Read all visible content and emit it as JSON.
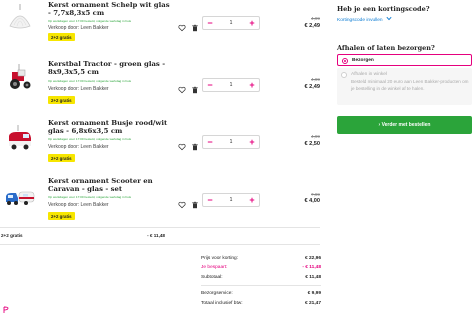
{
  "cart": {
    "items": [
      {
        "title": "Kerst ornament Schelp wit glas - 7,7x8,3x5 cm",
        "delivery": "Op werkdagen voor 17:00 besteld, volgende werkdag in huis",
        "seller": "Verkoop door: Leen Bakker",
        "badge": "2+2 gratis",
        "quantity": "1",
        "old_price": "4,99",
        "new_price": "€ 2,49",
        "thumb_icon": "shell-ornament-icon"
      },
      {
        "title": "Kerstbal Tractor - groen glas - 8x9,3x5,5 cm",
        "delivery": "Op werkdagen voor 17:00 besteld, volgende werkdag in huis",
        "seller": "Verkoop door: Leen Bakker",
        "badge": "2+2 gratis",
        "quantity": "1",
        "old_price": "4,99",
        "new_price": "€ 2,49",
        "thumb_icon": "tractor-ornament-icon"
      },
      {
        "title": "Kerst ornament Busje rood/wit glas - 6,8x6x3,5 cm",
        "delivery": "Op werkdagen voor 17:00 besteld, volgende werkdag in huis",
        "seller": "Verkoop door: Leen Bakker",
        "badge": "2+2 gratis",
        "quantity": "1",
        "old_price": "4,99",
        "new_price": "€ 2,50",
        "thumb_icon": "van-ornament-icon"
      },
      {
        "title": "Kerst ornament Scooter en Caravan - glas - set",
        "delivery": "Op werkdagen voor 17:00 besteld, volgende werkdag in huis",
        "seller": "Verkoop door: Leen Bakker",
        "badge": "2+2 gratis",
        "quantity": "1",
        "old_price": "7,99",
        "new_price": "€ 4,00",
        "thumb_icon": "scooter-caravan-ornament-icon"
      }
    ],
    "discount_label": "2+2 gratis",
    "discount_value": "- € 11,48"
  },
  "summary": {
    "price_label": "Prijs voor korting:",
    "price_value": "€ 22,96",
    "saved_label": "Je bespaart:",
    "saved_value": "- € 11,48",
    "subtotal_label": "Subtotaal:",
    "subtotal_value": "€ 11,48",
    "shipping_label": "Bezorgservice:",
    "shipping_value": "€ 9,99",
    "total_label": "Totaal inclusief btw:",
    "total_value": "€ 21,47"
  },
  "sidebar": {
    "discount_heading": "Heb je een kortingscode?",
    "discount_link": "Kortingscode invullen",
    "delivery_heading": "Afhalen of laten bezorgen?",
    "option_delivery": "Bezorgen",
    "option_pickup": "Afhalen in winkel",
    "option_pickup_desc": "Besteld minimaal 20 euro aan Leen Bakker-producten om je bestelling in de winkel af te halen.",
    "checkout_label": "Verder met bestellen"
  },
  "colors": {
    "accent": "#e5007e",
    "success": "#2ba43a",
    "badge": "#f7e600",
    "link": "#0b7bd3"
  }
}
